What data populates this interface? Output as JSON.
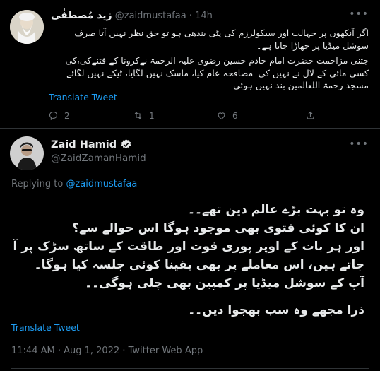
{
  "reply_tweet": {
    "name": "زید مُصطفٰی",
    "handle": "@zaidmustafaa",
    "time": "14h",
    "separator": "·",
    "body": [
      "اگر آنکھوں پر جہالت اور سیکولرزم کی پٹی بندھی ہو تو حق نظر نہیں آتا صرف سوشل میڈیا پر جھاڑا جاتا ہے۔",
      "جتنی مزاحمت حضرت امام خادم حسین رضوی علیہ الرحمۃ نےکرونا کے فتنےکی،کی کسی مائی کے لال نے نہیں کی۔مصافحہ عام کیا، ماسک نہیں لگایا، ٹیکے نہیں لگائے۔مسجد رحمۃ اللعالمین بند نہیں ہوئی"
    ],
    "translate_label": "Translate Tweet",
    "actions": {
      "replies": "2",
      "retweets": "1",
      "likes": "6"
    }
  },
  "main_tweet": {
    "name": "Zaid Hamid",
    "handle": "@ZaidZamanHamid",
    "replying_prefix": "Replying to",
    "replying_handle": "@zaidmustafaa",
    "body_lines": [
      "وہ تو بہت بڑے عالم دین تھے۔۔",
      "ان کا کوئی فتوی بھی موجود ہوگا اس حوالے سے؟",
      "اور ہر بات کے اوپر پوری قوت اور طاقت کے ساتھ سڑک پر آ جاتے ہیں، اس معاملے پر بھی یقینا کوئی جلسہ کیا ہوگا۔",
      "آپ کے سوشل میڈیا پر کمپین بھی چلی ہوگی۔۔"
    ],
    "body_closing": "ذرا مجھے وہ سب بھجوا دیں۔۔",
    "translate_label": "Translate Tweet",
    "timestamp": "11:44 AM · Aug 1, 2022 · Twitter Web App"
  },
  "icons": {
    "more": "more-icon",
    "reply": "reply-icon",
    "retweet": "retweet-icon",
    "like": "like-icon",
    "share": "share-icon",
    "verified": "verified-badge-icon"
  },
  "colors": {
    "background": "#000000",
    "link": "#1d9bf0",
    "muted": "#71767b",
    "text": "#e7e9ea"
  }
}
